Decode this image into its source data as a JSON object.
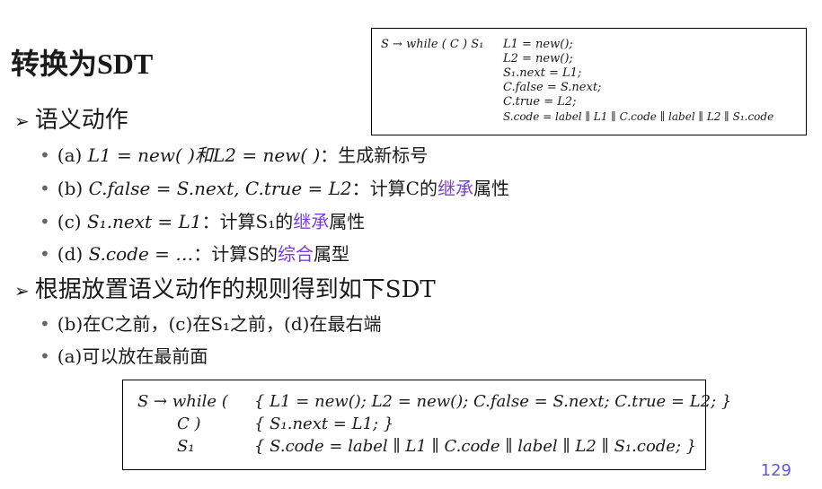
{
  "slide": {
    "title": "转换为SDT",
    "page_number": "129",
    "accent_color": "#7a3fd0"
  },
  "top_box": {
    "production": "S → while ( C ) S₁",
    "lines": [
      "L1 = new();",
      "L2 = new();",
      "S₁.next = L1;",
      "C.false = S.next;",
      "C.true = L2;",
      "S.code = label ∥ L1 ∥ C.code ∥ label ∥ L2 ∥ S₁.code"
    ]
  },
  "section1": {
    "heading": "语义动作",
    "items": [
      {
        "prefix": "(a) ",
        "math": "L1 = new( )和L2 = new( )",
        "text": "：生成新标号",
        "accent": "",
        "suffix": ""
      },
      {
        "prefix": "(b) ",
        "math": "C.false = S.next, C.true = L2",
        "text": "：计算C的",
        "accent": "继承",
        "suffix": "属性"
      },
      {
        "prefix": "(c) ",
        "math": "S₁.next = L1",
        "text": "：计算S₁的",
        "accent": "继承",
        "suffix": "属性"
      },
      {
        "prefix": "(d) ",
        "math": "S.code = …",
        "text": "：计算S的",
        "accent": "综合",
        "suffix": "属型"
      }
    ]
  },
  "section2": {
    "heading": "根据放置语义动作的规则得到如下SDT",
    "items": [
      "(b)在C之前，(c)在S₁之前，(d)在最右端",
      "(a)可以放在最前面"
    ]
  },
  "bottom_box": {
    "rows": [
      {
        "left": "S → while (",
        "right": "{ L1 = new(); L2 = new(); C.false = S.next; C.true = L2; }"
      },
      {
        "left": "C )",
        "right": "{ S₁.next = L1; }"
      },
      {
        "left": "S₁",
        "right": "{ S.code = label ∥ L1 ∥ C.code ∥ label ∥ L2 ∥ S₁.code; }"
      }
    ]
  }
}
